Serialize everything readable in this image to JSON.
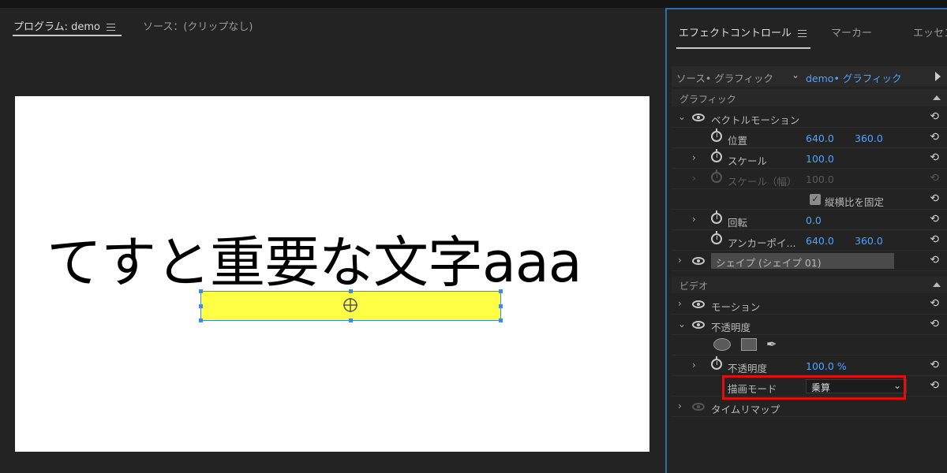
{
  "program": {
    "tab_program": "プログラム: demo",
    "tab_source": "ソース：(クリップなし)",
    "canvas_text": "てすと重要な文字aaa"
  },
  "effects": {
    "tab_effect_controls": "エフェクトコントロール",
    "tab_marker": "マーカー",
    "tab_essential": "エッセン",
    "source_label": "ソース• グラフィック",
    "clip_label": "demo• グラフィック",
    "section_graphic": "グラフィック",
    "vector_motion": "ベクトルモーション",
    "position_label": "位置",
    "position_x": "640.0",
    "position_y": "360.0",
    "scale_label": "スケール",
    "scale_value": "100.0",
    "scale_width_label": "スケール（幅）",
    "scale_width_value": "100.0",
    "uniform_scale_label": "縦横比を固定",
    "rotation_label": "回転",
    "rotation_value": "0.0",
    "anchor_label": "アンカーポイ...",
    "anchor_x": "640.0",
    "anchor_y": "360.0",
    "shape_label": "シェイプ (シェイプ 01)",
    "section_video": "ビデオ",
    "motion_label": "モーション",
    "opacity_group_label": "不透明度",
    "opacity_label": "不透明度",
    "opacity_value": "100.0 %",
    "blend_mode_label": "描画モード",
    "blend_mode_value": "乗算",
    "time_remap_label": "タイムリマップ"
  },
  "colors": {
    "accent_blue": "#4da3ff",
    "highlight_yellow": "#ffff46",
    "emphasis_red": "#e01010",
    "panel_border": "#2b6dad"
  },
  "icons": [
    "hamburger-menu-icon",
    "play-triangle-icon",
    "eye-icon",
    "stopwatch-icon",
    "reset-icon",
    "ellipse-mask-icon",
    "rectangle-mask-icon",
    "pen-mask-icon",
    "chevron-icon",
    "checkbox-checked-icon",
    "anchor-crosshair-icon"
  ]
}
